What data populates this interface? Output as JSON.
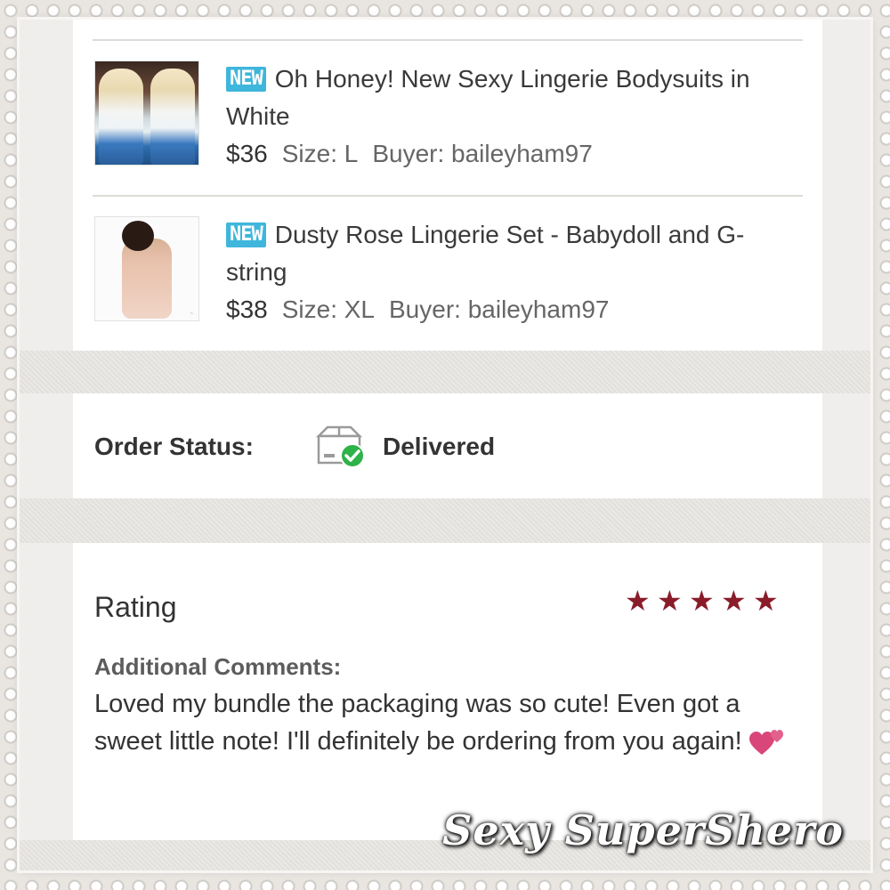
{
  "items": [
    {
      "badge": "NEW",
      "title": "Oh Honey! New Sexy Lingerie Bodysuits in White",
      "price": "$36",
      "size": "Size: L",
      "buyer": "Buyer: baileyham97"
    },
    {
      "badge": "NEW",
      "title": "Dusty Rose Lingerie Set - Babydoll and G-string",
      "price": "$38",
      "size": "Size: XL",
      "buyer": "Buyer: baileyham97"
    }
  ],
  "order": {
    "label": "Order Status:",
    "icon": "package-delivered-icon",
    "value": "Delivered"
  },
  "rating": {
    "label": "Rating",
    "stars": 5,
    "max_stars": 5,
    "star_color": "#8a1c2a",
    "comments_title": "Additional Comments:",
    "comments": "Loved my bundle the packaging was so cute! Even got a sweet little note! I'll definitely be ordering from you again!",
    "emoji": "two-hearts-icon"
  },
  "watermark": "Sexy SuperShero",
  "colors": {
    "badge": "#3fb6dc",
    "check": "#2fb24a"
  }
}
